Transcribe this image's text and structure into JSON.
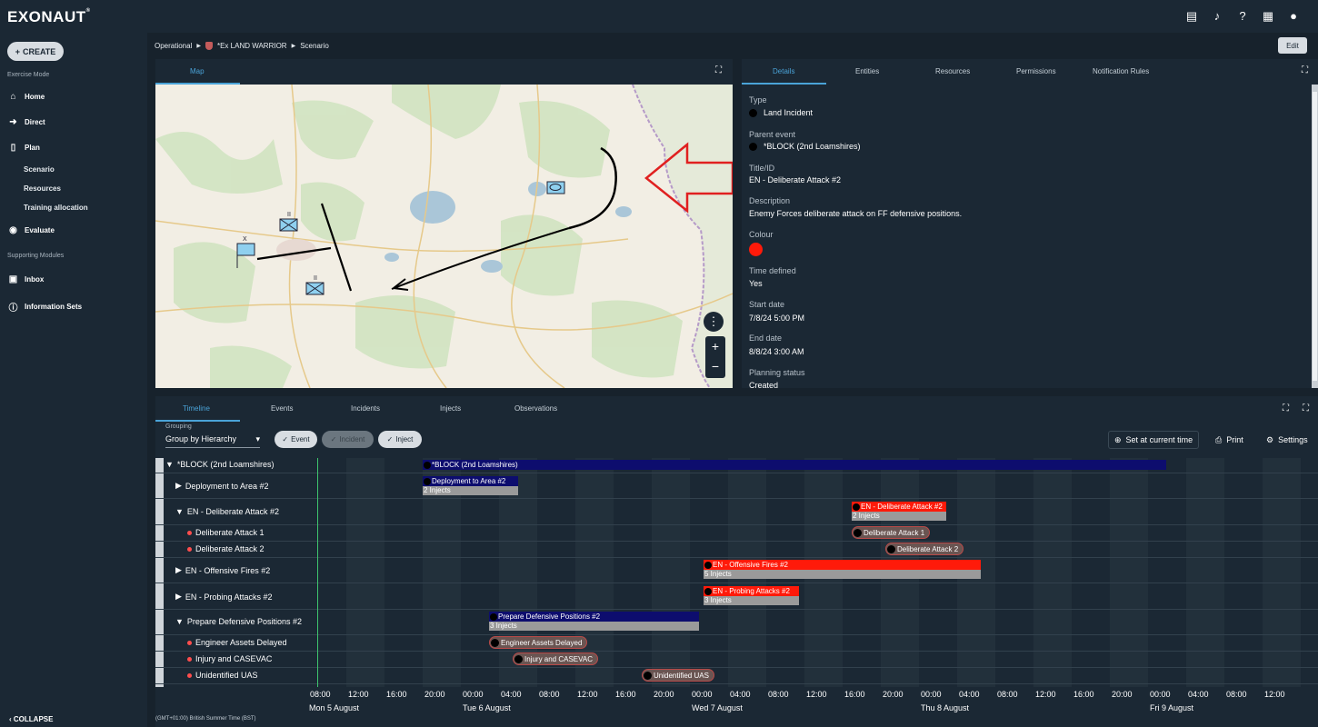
{
  "app": {
    "title": "EXONAUT",
    "mark": "®"
  },
  "topbar": {
    "icons": [
      "chat-icon",
      "bell-icon",
      "help-icon",
      "apps-grid-icon",
      "account-icon"
    ]
  },
  "nav": {
    "create": "CREATE",
    "exercise_mode": "Exercise Mode",
    "home": "Home",
    "direct": "Direct",
    "plan": "Plan",
    "scenario": "Scenario",
    "resources": "Resources",
    "training": "Training allocation",
    "evaluate": "Evaluate",
    "supporting": "Supporting Modules",
    "inbox": "Inbox",
    "infosets": "Information Sets",
    "collapse": "COLLAPSE"
  },
  "breadcrumb": {
    "root": "Operational",
    "exercise": "*Ex LAND WARRIOR",
    "page": "Scenario"
  },
  "edit_label": "Edit",
  "map": {
    "tab": "Map",
    "unit_label_x": "X",
    "unit_label_ii": "II"
  },
  "details": {
    "tabs": [
      "Details",
      "Entities",
      "Resources",
      "Permissions",
      "Notification Rules"
    ],
    "type_label": "Type",
    "type_value": "Land Incident",
    "parent_label": "Parent event",
    "parent_value": "*BLOCK (2nd Loamshires)",
    "title_label": "Title/ID",
    "title_value": "EN - Deliberate Attack #2",
    "desc_label": "Description",
    "desc_value": "Enemy Forces deliberate attack on FF defensive positions.",
    "colour_label": "Colour",
    "colour_value": "#ff1a0a",
    "time_label": "Time defined",
    "time_value": "Yes",
    "start_label": "Start date",
    "start_value": "7/8/24 5:00 PM",
    "end_label": "End date",
    "end_value": "8/8/24 3:00 AM",
    "planning_label": "Planning status",
    "planning_value": "Created"
  },
  "timeline": {
    "tabs": [
      "Timeline",
      "Events",
      "Incidents",
      "Injects",
      "Observations"
    ],
    "grouping_label": "Grouping",
    "grouping_value": "Group by Hierarchy",
    "chips": {
      "event": "Event",
      "incident": "Incident",
      "inject": "Inject"
    },
    "set_current": "Set at current time",
    "print": "Print",
    "settings": "Settings",
    "rows": [
      "*BLOCK (2nd Loamshires)",
      "Deployment to Area #2",
      "EN - Deliberate Attack #2",
      "Deliberate Attack 1",
      "Deliberate Attack 2",
      "EN - Offensive Fires #2",
      "EN - Probing Attacks #2",
      "Prepare Defensive Positions #2",
      "Engineer Assets Delayed",
      "Injury and CASEVAC",
      "Unidentified UAS"
    ],
    "bars": {
      "block": "*BLOCK (2nd Loamshires)",
      "deploy": "Deployment to Area #2",
      "deploy_sub": "2 Injects",
      "attack": "EN - Deliberate Attack #2",
      "attack_sub": "2 Injects",
      "fires": "EN - Offensive Fires #2",
      "fires_sub": "5 Injects",
      "probing": "EN - Probing Attacks #2",
      "probing_sub": "3 Injects",
      "prepare": "Prepare Defensive Positions #2",
      "prepare_sub": "3 Injects"
    },
    "injects": {
      "da1": "Deliberate Attack 1",
      "da2": "Deliberate Attack 2",
      "eng": "Engineer Assets Delayed",
      "inj": "Injury and CASEVAC",
      "uas": "Unidentified UAS"
    },
    "ticks": [
      "08:00",
      "12:00",
      "16:00",
      "20:00",
      "00:00",
      "04:00",
      "08:00",
      "12:00",
      "16:00",
      "20:00",
      "00:00",
      "04:00",
      "08:00",
      "12:00",
      "16:00",
      "20:00",
      "00:00",
      "04:00",
      "08:00",
      "12:00",
      "16:00",
      "20:00",
      "00:00",
      "04:00",
      "08:00",
      "12:00"
    ],
    "days": [
      "Mon 5 August",
      "Tue 6 August",
      "Wed 7 August",
      "Thu 8 August",
      "Fri 9 August"
    ],
    "timezone": "(GMT+01:00) British Summer Time (BST)"
  }
}
